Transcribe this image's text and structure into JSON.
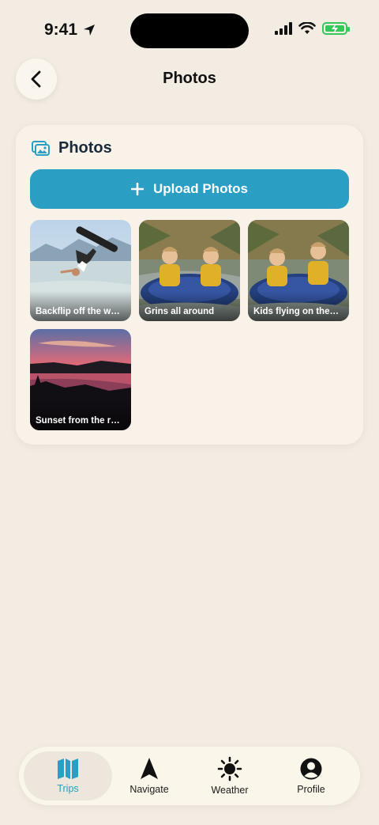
{
  "status": {
    "time": "9:41"
  },
  "header": {
    "title": "Photos"
  },
  "card": {
    "title": "Photos",
    "upload_label": "Upload Photos",
    "accent": "#2a9ec3"
  },
  "photos": [
    {
      "caption": "Backflip off the w…",
      "icon": "wakeboard-photo"
    },
    {
      "caption": "Grins all around",
      "icon": "tube-photo"
    },
    {
      "caption": "Kids flying on the…",
      "icon": "tube-photo"
    },
    {
      "caption": "Sunset from the r…",
      "icon": "sunset-photo"
    }
  ],
  "tabs": [
    {
      "label": "Trips",
      "icon": "map-icon",
      "active": true
    },
    {
      "label": "Navigate",
      "icon": "navigate-arrow-icon",
      "active": false
    },
    {
      "label": "Weather",
      "icon": "sun-icon",
      "active": false
    },
    {
      "label": "Profile",
      "icon": "profile-icon",
      "active": false
    }
  ]
}
